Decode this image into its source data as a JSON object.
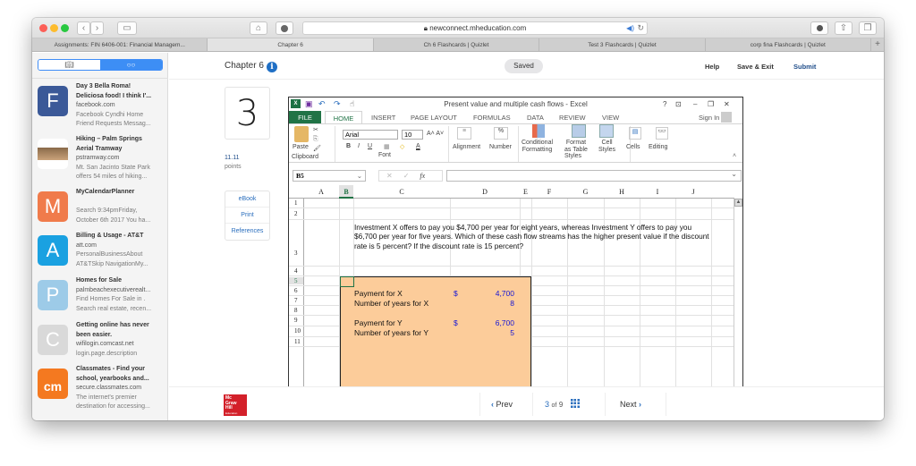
{
  "browser": {
    "url": "newconnect.mheducation.com",
    "tabs": [
      {
        "label": "Assignments: FIN 6406-001: Financial Managem..."
      },
      {
        "label": "Chapter 6",
        "active": true
      },
      {
        "label": "Ch 6 Flashcards | Quizlet"
      },
      {
        "label": "Test 3 Flashcards | Quizlet"
      },
      {
        "label": "corp fina Flashcards | Quizlet"
      }
    ],
    "new_tab": "+"
  },
  "sidebar": {
    "segments": [
      "bookmarks",
      "reading-list"
    ],
    "items": [
      {
        "icon_letter": "F",
        "icon_color": "#3b5998",
        "title": "Day 3 Bella Roma! Deliciosa food! I think I'...",
        "title1": "Day 3 Bella Roma!",
        "title2": "Deliciosa food! I think I'...",
        "domain": "facebook.com",
        "desc1": "Facebook Cyndhi Home",
        "desc2": "Friend Requests Messag..."
      },
      {
        "icon_letter": "",
        "icon_color": "#9a7a5a",
        "title1": "Hiking – Palm Springs",
        "title2": "Aerial Tramway",
        "domain": "pstramway.com",
        "desc1": "Mt. San Jacinto State Park",
        "desc2": "offers 54 miles of hiking..."
      },
      {
        "icon_letter": "M",
        "icon_color": "#f07b4b",
        "title1": "MyCalendarPlanner",
        "title2": "",
        "domain": "",
        "desc1": "Search 9:34pmFriday,",
        "desc2": "October 6th 2017 You ha..."
      },
      {
        "icon_letter": "A",
        "icon_color": "#1aa1e1",
        "title1": "Billing & Usage - AT&T",
        "title2": "",
        "domain": "att.com",
        "desc1": "PersonalBusinessAbout",
        "desc2": "AT&TSkip NavigationMy..."
      },
      {
        "icon_letter": "P",
        "icon_color": "#9dcbe8",
        "title1": "Homes for Sale",
        "title2": "",
        "domain": "palmbeachexecutiverealt...",
        "desc1": "Find Homes For Sale in .",
        "desc2": "Search real estate, recen..."
      },
      {
        "icon_letter": "C",
        "icon_color": "#d9d9d9",
        "title1": "Getting online has never",
        "title2": "been easier.",
        "domain": "wifilogin.comcast.net",
        "desc1": "login.page.description",
        "desc2": ""
      },
      {
        "icon_letter": "cm",
        "icon_color": "#f47920",
        "title1": "Classmates - Find your",
        "title2": "school, yearbooks and...",
        "domain": "secure.classmates.com",
        "desc1": "The internet's premier",
        "desc2": "destination for accessing..."
      }
    ]
  },
  "header": {
    "chapter": "Chapter 6",
    "saved": "Saved",
    "help": "Help",
    "save_exit": "Save & Exit",
    "submit": "Submit"
  },
  "question": {
    "number": "3",
    "points_value": "11.11",
    "points_label": "points",
    "links": [
      "eBook",
      "Print",
      "References"
    ]
  },
  "excel": {
    "title": "Present value and multiple cash flows - Excel",
    "ribbon_tabs": [
      "FILE",
      "HOME",
      "INSERT",
      "PAGE LAYOUT",
      "FORMULAS",
      "DATA",
      "REVIEW",
      "VIEW"
    ],
    "sign_in": "Sign In",
    "font_name": "Arial",
    "font_size": "10",
    "groups": {
      "clipboard": "Clipboard",
      "font": "Font",
      "styles": "Styles",
      "paste": "Paste",
      "alignment": "Alignment",
      "number": "Number",
      "conditional1": "Conditional",
      "conditional2": "Formatting",
      "format1": "Format",
      "format2": "as Table",
      "cell1": "Cell",
      "cell2": "Styles",
      "cells": "Cells",
      "editing": "Editing"
    },
    "name_box": "B5",
    "fx": "fx",
    "columns": [
      "A",
      "B",
      "C",
      "D",
      "E",
      "F",
      "G",
      "H",
      "I",
      "J"
    ],
    "rows": [
      "1",
      "2",
      "3",
      "4",
      "5",
      "6",
      "7",
      "8",
      "9",
      "10",
      "11"
    ],
    "question_text": "Investment X offers to pay you $4,700 per year for eight years, whereas Investment Y offers to pay you $6,700 per year for five years. Which of these cash flow streams has the higher present value if the discount rate is 5 percent? If the discount rate is 15 percent?",
    "inputs": [
      {
        "label": "Payment for X",
        "currency": "$",
        "value": "4,700"
      },
      {
        "label": "Number of years for X",
        "currency": "",
        "value": "8"
      },
      {
        "label": "Payment for Y",
        "currency": "$",
        "value": "6,700"
      },
      {
        "label": "Number of years for Y",
        "currency": "",
        "value": "5"
      }
    ]
  },
  "footer": {
    "logo": [
      "Mc",
      "Graw",
      "Hill",
      "Education"
    ],
    "prev": "Prev",
    "page_current": "3",
    "page_of": "of",
    "page_total": "9",
    "next": "Next"
  }
}
